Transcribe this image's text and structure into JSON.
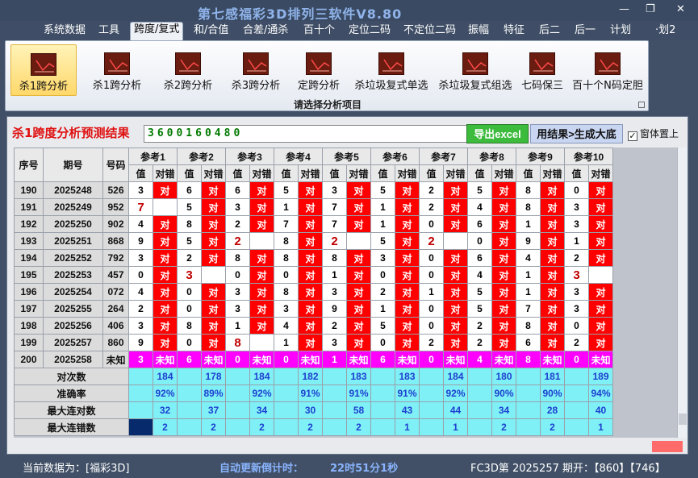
{
  "window": {
    "title": "第七感福彩3D排列三软件V8.80",
    "minimize": "—",
    "restore": "❐",
    "close": "✕"
  },
  "menu": [
    "系统数据",
    "工具",
    "跨度/复式",
    "和/合值",
    "合差/通杀",
    "百十个",
    "定位二码",
    "不定位二码",
    "振幅",
    "特征",
    "后二",
    "后一",
    "计划",
    "·划2"
  ],
  "menu_active": 2,
  "ribbon": {
    "items": [
      "杀1跨分析",
      "杀1跨分析",
      "杀2跨分析",
      "杀3跨分析",
      "定跨分析",
      "杀垃圾复式单选",
      "杀垃圾复式组选",
      "七码保三",
      "百十个N码定胆"
    ],
    "selected": 0,
    "caption": "请选择分析项目"
  },
  "result": {
    "label": "杀1跨度分析预测结果",
    "value": "3600160480",
    "excel_button": "导出excel",
    "big_button": "用结果>生成大底",
    "pin_checkbox": "窗体置上",
    "pin_checked": true
  },
  "table": {
    "headers": {
      "seq": "序号",
      "issue": "期号",
      "num": "号码",
      "val": "值",
      "match": "对错",
      "ref_prefix": "参考"
    },
    "refs": 10,
    "rows": [
      {
        "seq": "190",
        "issue": "2025248",
        "num": "526",
        "v": [
          "3",
          "6",
          "6",
          "5",
          "3",
          "5",
          "2",
          "5",
          "8",
          "0"
        ],
        "m": [
          "对",
          "对",
          "对",
          "对",
          "对",
          "对",
          "对",
          "对",
          "对",
          "对"
        ]
      },
      {
        "seq": "191",
        "issue": "2025249",
        "num": "952",
        "v": [
          "7",
          "5",
          "3",
          "1",
          "7",
          "1",
          "2",
          "4",
          "8",
          "3"
        ],
        "m": [
          "",
          "对",
          "对",
          "对",
          "对",
          "对",
          "对",
          "对",
          "对",
          "对"
        ]
      },
      {
        "seq": "192",
        "issue": "2025250",
        "num": "902",
        "v": [
          "4",
          "8",
          "2",
          "7",
          "7",
          "1",
          "0",
          "6",
          "1",
          "3"
        ],
        "m": [
          "对",
          "对",
          "对",
          "对",
          "对",
          "对",
          "对",
          "对",
          "对",
          "对"
        ]
      },
      {
        "seq": "193",
        "issue": "2025251",
        "num": "868",
        "v": [
          "9",
          "5",
          "2",
          "8",
          "2",
          "5",
          "2",
          "0",
          "9",
          "1"
        ],
        "m": [
          "对",
          "对",
          "",
          "对",
          "",
          "对",
          "",
          "对",
          "对",
          "对"
        ]
      },
      {
        "seq": "194",
        "issue": "2025252",
        "num": "792",
        "v": [
          "3",
          "2",
          "8",
          "8",
          "8",
          "3",
          "0",
          "6",
          "4",
          "2"
        ],
        "m": [
          "对",
          "对",
          "对",
          "对",
          "对",
          "对",
          "对",
          "对",
          "对",
          "对"
        ]
      },
      {
        "seq": "195",
        "issue": "2025253",
        "num": "457",
        "v": [
          "0",
          "3",
          "0",
          "0",
          "1",
          "0",
          "0",
          "4",
          "1",
          "3"
        ],
        "m": [
          "对",
          "",
          "对",
          "对",
          "对",
          "对",
          "对",
          "对",
          "对",
          ""
        ]
      },
      {
        "seq": "196",
        "issue": "2025254",
        "num": "072",
        "v": [
          "4",
          "0",
          "3",
          "8",
          "3",
          "2",
          "1",
          "5",
          "1",
          "3"
        ],
        "m": [
          "对",
          "对",
          "对",
          "对",
          "对",
          "对",
          "对",
          "对",
          "对",
          "对"
        ]
      },
      {
        "seq": "197",
        "issue": "2025255",
        "num": "264",
        "v": [
          "2",
          "0",
          "3",
          "3",
          "9",
          "1",
          "0",
          "5",
          "7",
          "3"
        ],
        "m": [
          "对",
          "对",
          "对",
          "对",
          "对",
          "对",
          "对",
          "对",
          "对",
          "对"
        ]
      },
      {
        "seq": "198",
        "issue": "2025256",
        "num": "406",
        "v": [
          "3",
          "8",
          "1",
          "4",
          "2",
          "5",
          "0",
          "2",
          "8",
          "0"
        ],
        "m": [
          "对",
          "对",
          "对",
          "对",
          "对",
          "对",
          "对",
          "对",
          "对",
          "对"
        ]
      },
      {
        "seq": "199",
        "issue": "2025257",
        "num": "860",
        "v": [
          "9",
          "0",
          "8",
          "1",
          "3",
          "0",
          "2",
          "2",
          "6",
          "2"
        ],
        "m": [
          "对",
          "对",
          "",
          "对",
          "对",
          "对",
          "对",
          "对",
          "对",
          "对"
        ]
      }
    ],
    "unknown_row": {
      "seq": "200",
      "issue": "2025258",
      "num": "未知",
      "v": [
        "3",
        "6",
        "0",
        "0",
        "1",
        "6",
        "0",
        "4",
        "8",
        "0"
      ],
      "m": "未知"
    },
    "summary": [
      {
        "label": "对次数",
        "values": [
          "184",
          "178",
          "184",
          "182",
          "183",
          "183",
          "184",
          "180",
          "181",
          "189"
        ]
      },
      {
        "label": "准确率",
        "values": [
          "92%",
          "89%",
          "92%",
          "91%",
          "91%",
          "91%",
          "92%",
          "90%",
          "90%",
          "94%"
        ]
      },
      {
        "label": "最大连对数",
        "values": [
          "32",
          "37",
          "34",
          "30",
          "58",
          "43",
          "44",
          "34",
          "28",
          "40"
        ]
      },
      {
        "label": "最大连错数",
        "values": [
          "2",
          "2",
          "2",
          "2",
          "2",
          "1",
          "1",
          "2",
          "2",
          "1"
        ]
      }
    ]
  },
  "status": {
    "current": "当前数据为：[福彩3D]",
    "countdown_label": "自动更新倒计时：",
    "countdown": "22时51分1秒",
    "issue": "FC3D第 2025257 期开：【860】【746】"
  },
  "colors": {
    "match": "#ff0000",
    "unknown": "#ff00ff",
    "summary": "#7ff0f6",
    "summary_text": "#1e3fd0"
  }
}
